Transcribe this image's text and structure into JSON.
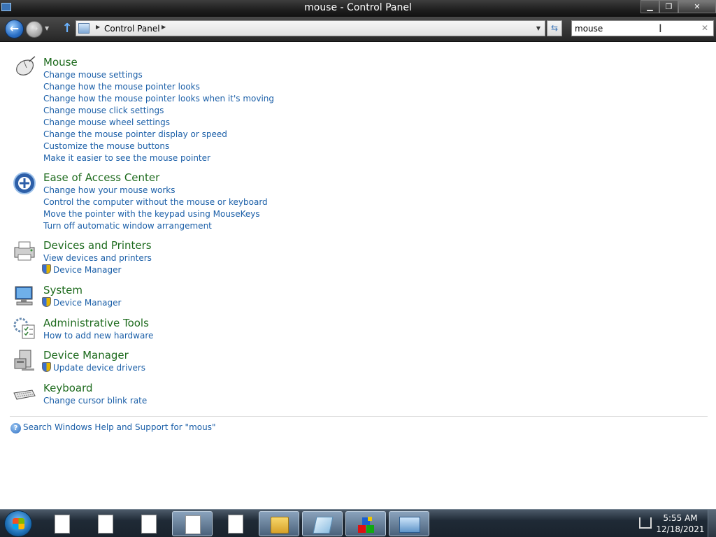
{
  "window": {
    "title": "mouse - Control Panel",
    "buttons": {
      "minimize": "▁",
      "maximize": "❐",
      "close": "✕"
    }
  },
  "address_bar": {
    "breadcrumb": [
      "Control Panel"
    ],
    "search_value": "mouse",
    "nav": {
      "back": "←",
      "forward": "→",
      "up": "↑",
      "refresh": "⇆"
    }
  },
  "results": [
    {
      "heading": "Mouse",
      "icon": "mouse-icon",
      "links": [
        {
          "text": "Change mouse settings",
          "shield": false
        },
        {
          "text": "Change how the mouse pointer looks",
          "shield": false
        },
        {
          "text": "Change how the mouse pointer looks when it's moving",
          "shield": false
        },
        {
          "text": "Change mouse click settings",
          "shield": false
        },
        {
          "text": "Change mouse wheel settings",
          "shield": false
        },
        {
          "text": "Change the mouse pointer display or speed",
          "shield": false
        },
        {
          "text": "Customize the mouse buttons",
          "shield": false
        },
        {
          "text": "Make it easier to see the mouse pointer",
          "shield": false
        }
      ]
    },
    {
      "heading": "Ease of Access Center",
      "icon": "ease-of-access-icon",
      "links": [
        {
          "text": "Change how your mouse works",
          "shield": false
        },
        {
          "text": "Control the computer without the mouse or keyboard",
          "shield": false
        },
        {
          "text": "Move the pointer with the keypad using MouseKeys",
          "shield": false
        },
        {
          "text": "Turn off automatic window arrangement",
          "shield": false
        }
      ]
    },
    {
      "heading": "Devices and Printers",
      "icon": "printer-icon",
      "links": [
        {
          "text": "View devices and printers",
          "shield": false
        },
        {
          "text": "Device Manager",
          "shield": true
        }
      ]
    },
    {
      "heading": "System",
      "icon": "computer-icon",
      "links": [
        {
          "text": "Device Manager",
          "shield": true
        }
      ]
    },
    {
      "heading": "Administrative Tools",
      "icon": "admin-tools-icon",
      "links": [
        {
          "text": "How to add new hardware",
          "shield": false
        }
      ]
    },
    {
      "heading": "Device Manager",
      "icon": "device-manager-icon",
      "links": [
        {
          "text": "Update device drivers",
          "shield": true
        }
      ]
    },
    {
      "heading": "Keyboard",
      "icon": "keyboard-icon",
      "links": [
        {
          "text": "Change cursor blink rate",
          "shield": false
        }
      ]
    }
  ],
  "help_link": "Search Windows Help and Support for \"mous\"",
  "taskbar": {
    "time": "5:55 AM",
    "date": "12/18/2021",
    "buttons": [
      "document-icon",
      "document-icon",
      "document-icon",
      "document-icon",
      "document-icon",
      "folder-icon",
      "paper-icon",
      "multi-color-app-icon",
      "control-panel-icon"
    ]
  }
}
